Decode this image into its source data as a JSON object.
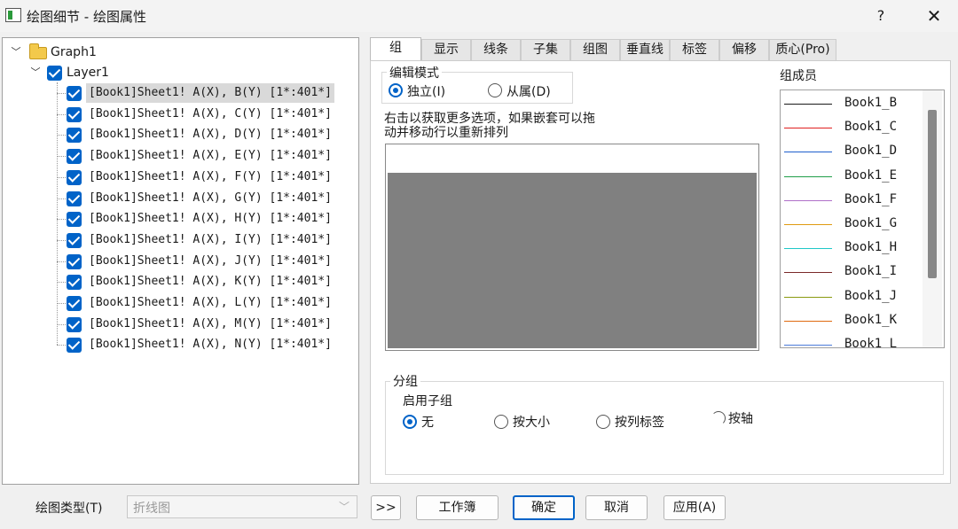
{
  "window": {
    "title": "绘图细节 - 绘图属性",
    "help": "?",
    "close": "✕"
  },
  "tree": {
    "graph": "Graph1",
    "layer": "Layer1",
    "plots": [
      "[Book1]Sheet1! A(X), B(Y) [1*:401*]",
      "[Book1]Sheet1! A(X), C(Y) [1*:401*]",
      "[Book1]Sheet1! A(X), D(Y) [1*:401*]",
      "[Book1]Sheet1! A(X), E(Y) [1*:401*]",
      "[Book1]Sheet1! A(X), F(Y) [1*:401*]",
      "[Book1]Sheet1! A(X), G(Y) [1*:401*]",
      "[Book1]Sheet1! A(X), H(Y) [1*:401*]",
      "[Book1]Sheet1! A(X), I(Y) [1*:401*]",
      "[Book1]Sheet1! A(X), J(Y) [1*:401*]",
      "[Book1]Sheet1! A(X), K(Y) [1*:401*]",
      "[Book1]Sheet1! A(X), L(Y) [1*:401*]",
      "[Book1]Sheet1! A(X), M(Y) [1*:401*]",
      "[Book1]Sheet1! A(X), N(Y) [1*:401*]"
    ]
  },
  "tabs": [
    "组",
    "显示",
    "线条",
    "子集",
    "组图",
    "垂直线",
    "标签",
    "偏移",
    "质心(Pro)"
  ],
  "edit_mode": {
    "legend": "编辑模式",
    "independent": "独立(I)",
    "dependent": "从属(D)",
    "hint_line1": "右击以获取更多选项，如果嵌套可以拖",
    "hint_line2": "动并移动行以重新排列"
  },
  "members": {
    "title": "组成员",
    "items": [
      {
        "name": "Book1_B",
        "color": "#1a1a1a"
      },
      {
        "name": "Book1_C",
        "color": "#e02020"
      },
      {
        "name": "Book1_D",
        "color": "#1f5fcc"
      },
      {
        "name": "Book1_E",
        "color": "#1f9e4a"
      },
      {
        "name": "Book1_F",
        "color": "#b070c8"
      },
      {
        "name": "Book1_G",
        "color": "#e09a10"
      },
      {
        "name": "Book1_H",
        "color": "#20c8c8"
      },
      {
        "name": "Book1_I",
        "color": "#7a2a2a"
      },
      {
        "name": "Book1_J",
        "color": "#8a9a10"
      },
      {
        "name": "Book1_K",
        "color": "#e06a10"
      },
      {
        "name": "Book1_L",
        "color": "#4a7ad8"
      }
    ]
  },
  "grouping": {
    "legend": "分组",
    "enable_label": "启用子组",
    "opt_none": "无",
    "opt_size": "按大小",
    "opt_col_label": "按列标签",
    "opt_axis": "按轴"
  },
  "bottom": {
    "plot_type_label": "绘图类型(T)",
    "plot_type_value": "折线图",
    "expand": ">>",
    "workbook": "工作簿",
    "ok": "确定",
    "cancel": "取消",
    "apply": "应用(A)"
  }
}
